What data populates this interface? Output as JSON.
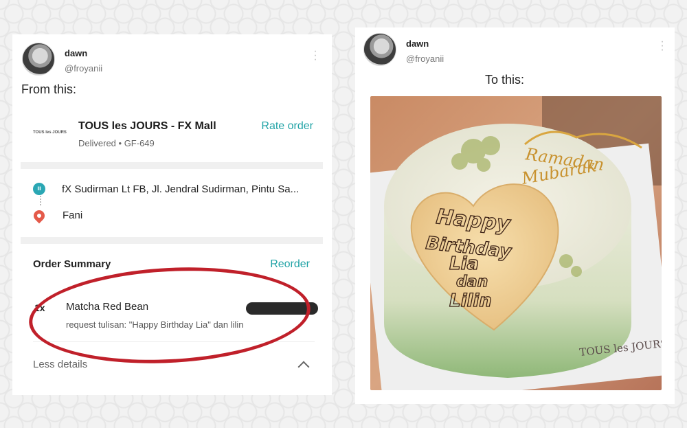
{
  "left_tweet": {
    "display_name": "dawn",
    "handle": "@froyanii",
    "caption": "From this:"
  },
  "order_screen": {
    "store_logo_text": "TOUS les JOURS",
    "store_name": "TOUS les JOURS - FX Mall",
    "status": "Delivered • GF-649",
    "rate_order": "Rate order",
    "pickup_address": "fX Sudirman Lt FB, Jl. Jendral Sudirman, Pintu Sa...",
    "dropoff_name": "Fani",
    "summary_title": "Order Summary",
    "reorder": "Reorder",
    "item": {
      "qty": "1x",
      "name": "Matcha Red Bean",
      "note": "request tulisan: \"Happy Birthday Lia\" dan lilin"
    },
    "less_details": "Less details"
  },
  "right_tweet": {
    "display_name": "dawn",
    "handle": "@froyanii",
    "caption": "To this:"
  },
  "photo": {
    "topper_line1": "Ramadan",
    "topper_line2": "Mubarak",
    "cookie_lines": [
      "Happy",
      "Birthday",
      "Lia",
      "dan",
      "Lilin"
    ],
    "board_brand": "TOUS les JOURS"
  },
  "colors": {
    "accent_teal": "#21a3a6",
    "annotation_red": "#c0202a",
    "cake_green": "#9fc08a",
    "cookie": "#f3d7a3"
  }
}
